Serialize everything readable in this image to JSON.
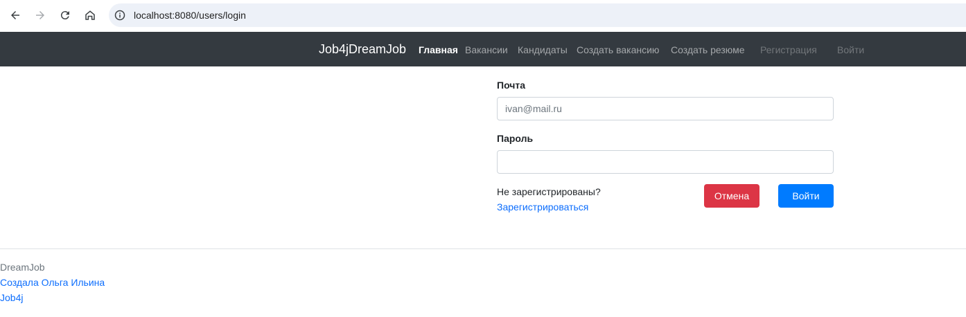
{
  "browser": {
    "url": "localhost:8080/users/login"
  },
  "navbar": {
    "brand": "Job4jDreamJob",
    "links": [
      {
        "label": "Главная"
      },
      {
        "label": "Вакансии"
      },
      {
        "label": "Кандидаты"
      },
      {
        "label": "Создать вакансию"
      },
      {
        "label": "Создать резюме"
      },
      {
        "label": "Регистрация"
      },
      {
        "label": "Войти"
      }
    ]
  },
  "form": {
    "email_label": "Почта",
    "email_placeholder": "ivan@mail.ru",
    "password_label": "Пароль",
    "password_value": "",
    "not_registered_text": "Не зарегистрированы?",
    "register_link": "Зарегистрироваться",
    "cancel_button": "Отмена",
    "login_button": "Войти"
  },
  "footer": {
    "brand": "DreamJob",
    "author_link": "Создала Ольга Ильина",
    "job4j_link": "Job4j"
  },
  "colors": {
    "navbar_bg": "#343a40",
    "cancel_button": "#dc3545",
    "login_button": "#007bff",
    "link": "#0d6efd"
  }
}
